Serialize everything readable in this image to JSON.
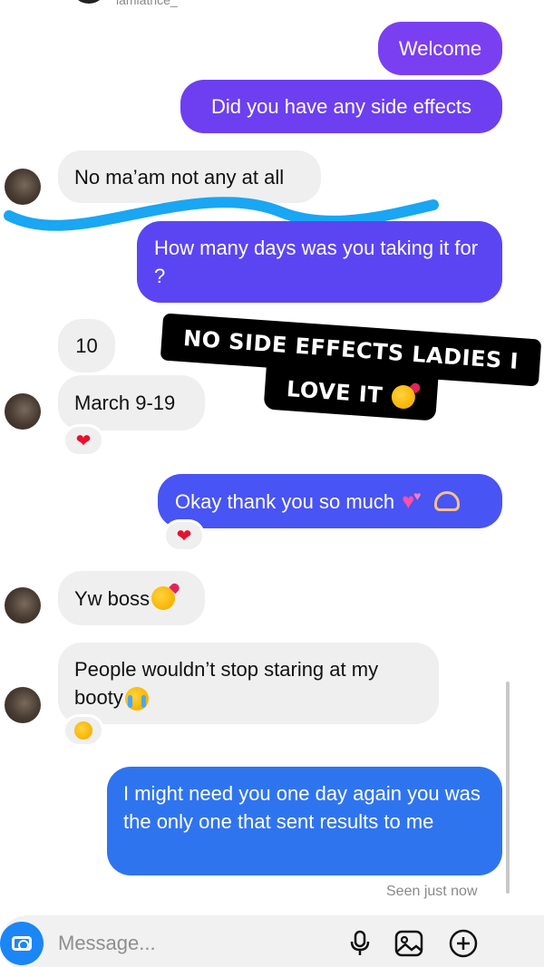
{
  "header": {
    "username": "iamiatrice_"
  },
  "messages": {
    "welcome": "Welcome",
    "side_effects": "Did you have any side effects",
    "no_maam": "No ma’am not any at all",
    "how_many": "How many days was you taking it for ?",
    "ten": "10",
    "march": "March 9-19",
    "okay": "Okay thank you so much",
    "yw": "Yw boss",
    "people": "People wouldn’t stop staring at my booty",
    "might": "I might need you one day again you was the only one that sent results to me"
  },
  "overlay": {
    "line1": "NO SIDE EFFECTS LADIES I",
    "line2": "LOVE IT"
  },
  "status": {
    "seen": "Seen just now"
  },
  "composer": {
    "placeholder": "Message..."
  },
  "colors": {
    "outgoing_purple": "#7b3ff2",
    "outgoing_blue": "#2f74ef",
    "incoming_gray": "#efefef",
    "camera_blue": "#1b86f5"
  }
}
